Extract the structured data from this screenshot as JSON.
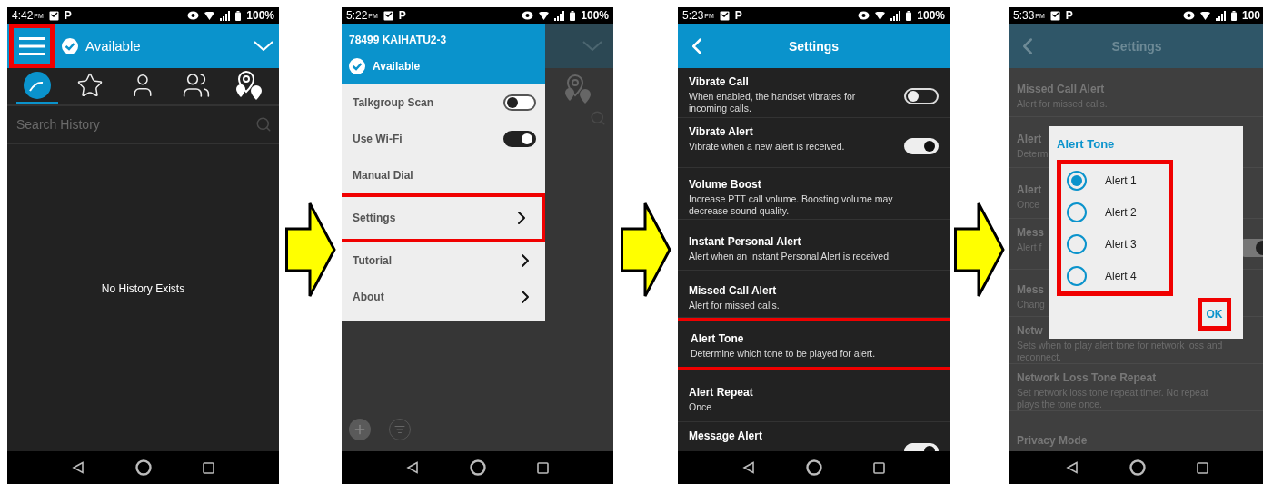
{
  "screens": [
    {
      "kind": "history",
      "status_bar": {
        "time": "4:42",
        "meridiem": "PM",
        "notice": "P",
        "battery": "100%"
      },
      "header": {
        "menu_highlighted": true,
        "presence": "Available"
      },
      "tabs": [
        {
          "selected": true
        },
        {
          "selected": false
        },
        {
          "selected": false
        },
        {
          "selected": false
        },
        {
          "selected": false
        }
      ],
      "search": {
        "placeholder": "Search History"
      },
      "empty_message": "No History Exists"
    },
    {
      "kind": "drawer",
      "status_bar": {
        "time": "5:22",
        "meridiem": "PM",
        "notice": "P",
        "battery": "100%"
      },
      "drawer": {
        "user": "78499 KAIHATU2-3",
        "presence": "Available",
        "items": [
          {
            "kind": "toggle",
            "label": "Talkgroup Scan",
            "on": false,
            "highlighted": false
          },
          {
            "kind": "toggle",
            "label": "Use Wi-Fi",
            "on": true,
            "highlighted": false
          },
          {
            "kind": "plain",
            "label": "Manual Dial",
            "highlighted": false
          },
          {
            "kind": "link",
            "label": "Settings",
            "highlighted": true
          },
          {
            "kind": "link",
            "label": "Tutorial",
            "highlighted": false
          },
          {
            "kind": "link",
            "label": "About",
            "highlighted": false
          }
        ]
      }
    },
    {
      "kind": "settings",
      "status_bar": {
        "time": "5:23",
        "meridiem": "PM",
        "notice": "P",
        "battery": "100%"
      },
      "title": "Settings",
      "rows": [
        {
          "kind": "toggle",
          "title": "Vibrate Call",
          "description": "When enabled, the handset vibrates for incoming calls.",
          "on": false,
          "highlighted": false
        },
        {
          "kind": "toggle",
          "title": "Vibrate Alert",
          "description": "Vibrate when a new alert is received.",
          "on": true,
          "highlighted": false
        },
        {
          "kind": "text",
          "title": "Volume Boost",
          "description": "Increase PTT call volume. Boosting volume may decrease sound quality.",
          "highlighted": false
        },
        {
          "kind": "text",
          "title": "Instant Personal Alert",
          "description": "Alert when an Instant Personal Alert is received.",
          "highlighted": false
        },
        {
          "kind": "text",
          "title": "Missed Call Alert",
          "description": "Alert for missed calls.",
          "highlighted": false
        },
        {
          "kind": "text",
          "title": "Alert Tone",
          "description": "Determine which tone to be played for alert.",
          "highlighted": true
        },
        {
          "kind": "text",
          "title": "Alert Repeat",
          "description": "Once",
          "highlighted": false
        },
        {
          "kind": "toggle",
          "title": "Message Alert",
          "on": true,
          "highlighted": false
        }
      ]
    },
    {
      "kind": "settings_dialog",
      "status_bar": {
        "time": "5:33",
        "meridiem": "PM",
        "notice": "P",
        "battery": "100"
      },
      "title": "Settings",
      "rows": [
        {
          "kind": "text",
          "title": "Missed Call Alert",
          "description": "Alert for missed calls.",
          "highlighted": false
        },
        {
          "kind": "text",
          "title": "Alert",
          "description": "Determ",
          "highlighted": false
        },
        {
          "kind": "text",
          "title": "Alert",
          "description": "Once",
          "highlighted": false
        },
        {
          "kind": "toggle",
          "title": "Mess",
          "description": "Alert f",
          "on": true,
          "highlighted": false
        },
        {
          "kind": "text",
          "title": "Mess",
          "description": "Chang",
          "highlighted": false
        },
        {
          "kind": "text",
          "title": "Netw",
          "description": "Sets when to play alert tone for network loss and reconnect.",
          "highlighted": false
        },
        {
          "kind": "text",
          "title": "Network Loss Tone Repeat",
          "description": "Set network loss tone repeat timer. No repeat plays the tone once.",
          "highlighted": false
        },
        {
          "kind": "text",
          "title": "Privacy Mode",
          "highlighted": false
        }
      ],
      "dialog": {
        "title": "Alert Tone",
        "options_highlighted": true,
        "options": [
          {
            "label": "Alert 1",
            "selected": true
          },
          {
            "label": "Alert 2",
            "selected": false
          },
          {
            "label": "Alert 3",
            "selected": false
          },
          {
            "label": "Alert 4",
            "selected": false
          }
        ],
        "ok": "OK",
        "ok_highlighted": true
      }
    }
  ]
}
